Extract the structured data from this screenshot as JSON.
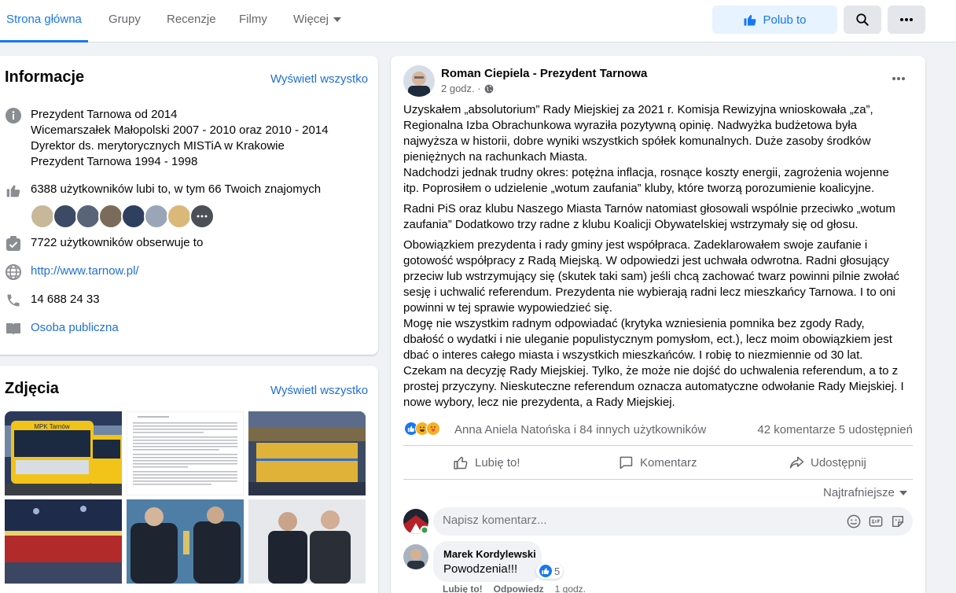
{
  "nav": {
    "tabs": [
      {
        "label": "Strona główna",
        "active": true
      },
      {
        "label": "Grupy"
      },
      {
        "label": "Recenzje"
      },
      {
        "label": "Filmy"
      },
      {
        "label": "Więcej"
      }
    ],
    "like_button": "Polub to",
    "accent": "#1877f2"
  },
  "info": {
    "title": "Informacje",
    "see_all": "Wyświetl wszystko",
    "bio": [
      "Prezydent Tarnowa od 2014",
      "Wicemarszałek Małopolski 2007 - 2010 oraz 2010 - 2014",
      "Dyrektor ds. merytorycznych MISTiA w Krakowie",
      "Prezydent Tarnowa 1994 - 1998"
    ],
    "likes": "6388 użytkowników lubi to, w tym 66 Twoich znajomych",
    "followers": "7722 użytkowników obserwuje to",
    "website": "http://www.tarnow.pl/",
    "phone": "14 688 24 33",
    "category": "Osoba publiczna"
  },
  "photos": {
    "title": "Zdjęcia",
    "see_all": "Wyświetl wszystko",
    "bus_label": "MPK Tarnów"
  },
  "post": {
    "author": "Roman Ciepiela - Prezydent Tarnowa",
    "time": "2 godz. ·",
    "paragraphs": [
      "Uzyskałem „absolutorium” Rady Miejskiej za 2021 r. Komisja Rewizyjna wnioskowała „za”, Regionalna Izba Obrachunkowa wyraziła pozytywną opinię. Nadwyżka budżetowa była najwyższa w historii, dobre wyniki wszystkich spółek komunalnych. Duże zasoby środków pieniężnych na rachunkach Miasta.\nNadchodzi jednak trudny okres: potężna inflacja, rosnące koszty energii, zagrożenia wojenne itp. Poprosiłem o  udzielenie „wotum zaufania” kluby, które  tworzą porozumienie koalicyjne.",
      "Radni PiS oraz klubu Naszego Miasta Tarnów natomiast głosowali wspólnie przeciwko „wotum zaufania” Dodatkowo trzy radne z klubu Koalicji Obywatelskiej  wstrzymały się od głosu.",
      "Obowiązkiem prezydenta i rady gminy jest współpraca. Zadeklarowałem swoje zaufanie i gotowość współpracy z Radą Miejską. W odpowiedzi jest uchwała odwrotna. Radni głosujący przeciw lub wstrzymujący się (skutek taki sam) jeśli chcą zachować twarz powinni pilnie zwołać sesję i uchwalić referendum. Prezydenta nie wybierają radni lecz mieszkańcy Tarnowa. I to oni powinni w tej sprawie wypowiedzieć się.\nMogę nie wszystkim radnym odpowiadać (krytyka wzniesienia pomnika bez zgody Rady, dbałość o wydatki i nie uleganie populistycznym pomysłom, ect.), lecz moim obowiązkiem jest dbać o interes całego miasta i wszystkich mieszkańców. I robię to niezmiennie od 30 lat.\nCzekam na decyzję Rady Miejskiej. Tylko, że może nie dojść do uchwalenia referendum, a to z prostej przyczyny. Nieskuteczne referendum oznacza automatyczne odwołanie Rady Miejskiej. I nowe wybory, lecz nie prezydenta, a Rady Miejskiej."
    ],
    "reactions_names": "Anna Aniela Natońska i 84 innych użytkowników",
    "counts": "42 komentarze  5 udostępnień",
    "actions": {
      "like": "Lubię to!",
      "comment": "Komentarz",
      "share": "Udostępnij"
    },
    "sort": "Najtrafniejsze",
    "comment_placeholder": "Napisz komentarz...",
    "comment": {
      "author": "Marek Kordylewski",
      "text": "Powodzenia!!!",
      "likes": "5",
      "like": "Lubię to!",
      "reply": "Odpowiedz",
      "time": "1 godz."
    }
  }
}
